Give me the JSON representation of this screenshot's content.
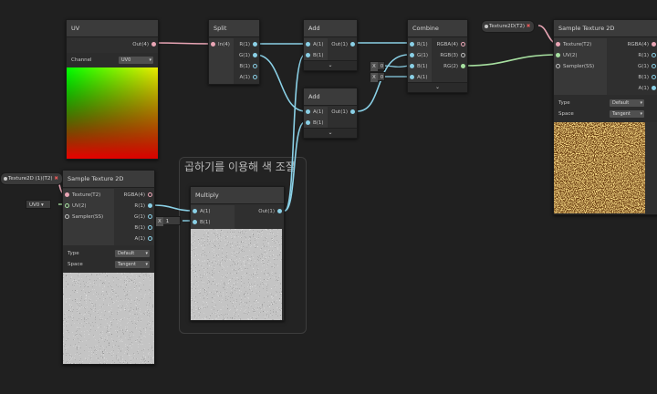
{
  "group": {
    "title": "곱하기를 이용해 색 조절"
  },
  "nodes": {
    "uv": {
      "title": "UV",
      "out": "Out(4)",
      "channel_label": "Channel",
      "channel_value": "UV0"
    },
    "split": {
      "title": "Split",
      "in": "In(4)",
      "outs": [
        "R(1)",
        "G(1)",
        "B(1)",
        "A(1)"
      ]
    },
    "add1": {
      "title": "Add",
      "ins": [
        "A(1)",
        "B(1)"
      ],
      "out": "Out(1)"
    },
    "add2": {
      "title": "Add",
      "ins": [
        "A(1)",
        "B(1)"
      ],
      "out": "Out(1)"
    },
    "combine": {
      "title": "Combine",
      "ins": [
        "R(1)",
        "G(1)",
        "B(1)",
        "A(1)"
      ],
      "outs": [
        "RGBA(4)",
        "RGB(3)",
        "RG(2)"
      ],
      "field_b": {
        "label": "X",
        "value": "0"
      },
      "field_a": {
        "label": "X",
        "value": "0"
      }
    },
    "sample_left": {
      "title": "Sample Texture 2D",
      "ins": [
        "Texture(T2)",
        "UV(2)",
        "Sampler(SS)"
      ],
      "outs": [
        "RGBA(4)",
        "R(1)",
        "G(1)",
        "B(1)",
        "A(1)"
      ],
      "type_label": "Type",
      "type_value": "Default",
      "space_label": "Space",
      "space_value": "Tangent",
      "uv_field": "UV0"
    },
    "multiply": {
      "title": "Multiply",
      "ins": [
        "A(1)",
        "B(1)"
      ],
      "out": "Out(1)",
      "field_b": {
        "label": "X",
        "value": "1"
      }
    },
    "sample_right": {
      "title": "Sample Texture 2D",
      "ins": [
        "Texture(T2)",
        "UV(2)",
        "Sampler(SS)"
      ],
      "outs": [
        "RGBA(4)",
        "R(1)",
        "G(1)",
        "B(1)",
        "A(1)"
      ],
      "type_label": "Type",
      "type_value": "Default",
      "space_label": "Space",
      "space_value": "Tangent"
    }
  },
  "properties": {
    "texture_left": "Texture2D (1)(T2)",
    "texture_right": "Texture2D(T2)"
  },
  "icons": {
    "remove": "x-mark-icon",
    "collapse": "chevron-down-icon",
    "dropdown": "caret-down-icon"
  },
  "colors": {
    "background": "#202020",
    "wire_float": "#8ad0e6",
    "wire_vector2": "#a7e0a0",
    "wire_vector4": "#e9a5b5",
    "wire_texture": "#e9a5b5"
  }
}
